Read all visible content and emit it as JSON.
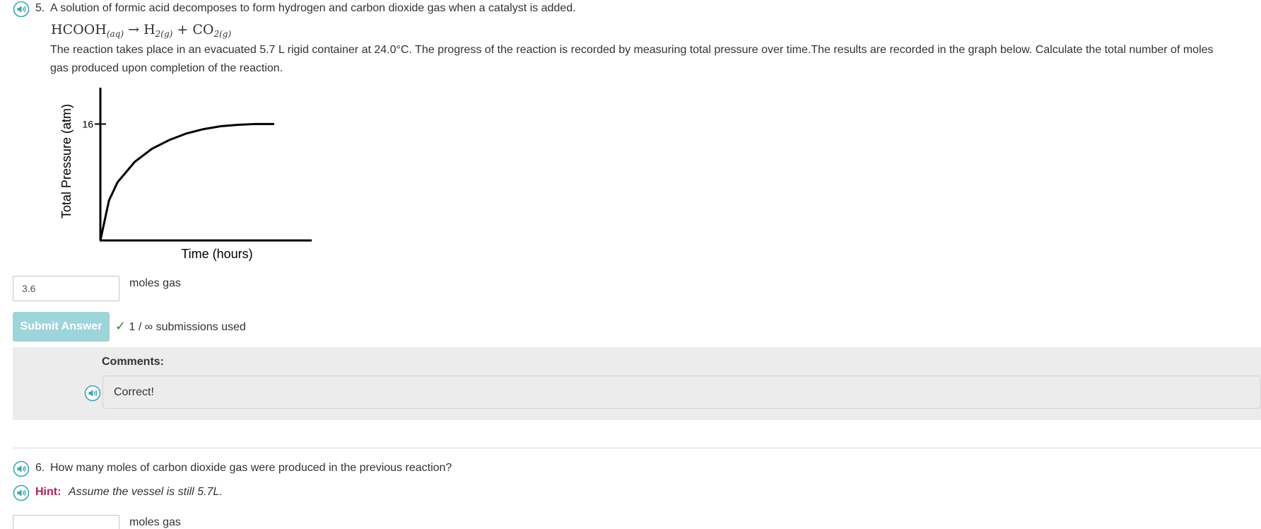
{
  "q5": {
    "number": "5.",
    "text": "A solution of formic acid decomposes to form hydrogen and carbon dioxide gas when a catalyst is added.",
    "equation": {
      "reactant": "HCOOH",
      "reactant_state": "(aq)",
      "arrow": "→",
      "product1": "H",
      "product1_sub": "2(g)",
      "plus": "+",
      "product2": "CO",
      "product2_sub": "2(g)"
    },
    "paragraph": "The reaction takes place in an evacuated 5.7 L rigid container at 24.0°C. The progress of the reaction is recorded by measuring total pressure over time.The results are recorded in the graph below. Calculate the total number of moles gas produced upon completion of the reaction.",
    "answer_value": "3.6",
    "units": "moles gas",
    "submit_label": "Submit Answer",
    "status_check": "✓",
    "status_text": "1 / ∞ submissions used",
    "comments_title": "Comments:",
    "comment_text": "Correct!"
  },
  "chart_data": {
    "type": "line",
    "xlabel": "Time (hours)",
    "ylabel": "Total Pressure (atm)",
    "yticks": [
      "16"
    ],
    "x": [
      0,
      0.05,
      0.1,
      0.2,
      0.3,
      0.4,
      0.5,
      0.6,
      0.7,
      0.8,
      0.9,
      1.0
    ],
    "series": [
      {
        "values": [
          0,
          5.5,
          8.0,
          10.8,
          12.6,
          13.8,
          14.7,
          15.3,
          15.7,
          15.9,
          16.0,
          16.0
        ]
      }
    ],
    "ylim": [
      0,
      21
    ],
    "grid": false
  },
  "q6": {
    "number": "6.",
    "text": "How many moles of carbon dioxide gas were produced in the previous reaction?",
    "hint_label": "Hint:",
    "hint_text": "Assume the vessel is still 5.7L.",
    "answer_value": "",
    "units": "moles gas"
  },
  "icons": {
    "audio": "speaker-icon"
  },
  "colors": {
    "accent": "#3aa7b3",
    "submit_disabled": "#9ed5db",
    "hint": "#c2185b",
    "check": "#2e8b3a",
    "panel": "#ececec"
  }
}
